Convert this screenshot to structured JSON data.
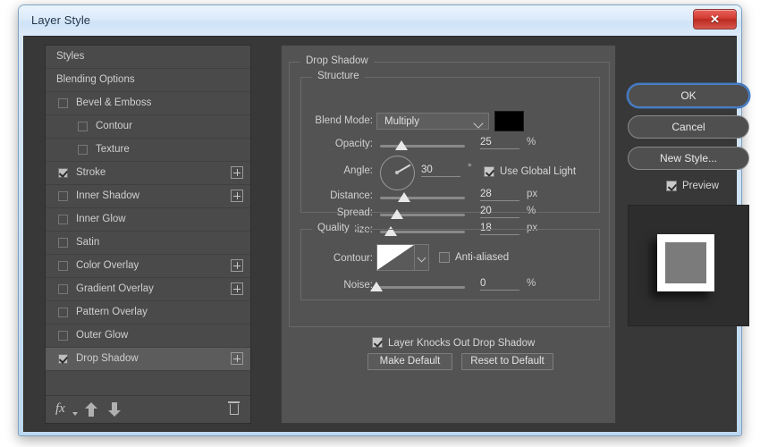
{
  "window": {
    "title": "Layer Style",
    "close_label": "✕"
  },
  "styles_panel": {
    "rows": [
      {
        "label": "Styles",
        "type": "header",
        "indent": 0,
        "checkbox": null,
        "plus": false
      },
      {
        "label": "Blending Options",
        "type": "header",
        "indent": 0,
        "checkbox": null,
        "plus": false
      },
      {
        "label": "Bevel & Emboss",
        "type": "item",
        "indent": 0,
        "checkbox": "off",
        "plus": false
      },
      {
        "label": "Contour",
        "type": "item",
        "indent": 1,
        "checkbox": "off",
        "plus": false
      },
      {
        "label": "Texture",
        "type": "item",
        "indent": 1,
        "checkbox": "off",
        "plus": false
      },
      {
        "label": "Stroke",
        "type": "item",
        "indent": 0,
        "checkbox": "on",
        "plus": true
      },
      {
        "label": "Inner Shadow",
        "type": "item",
        "indent": 0,
        "checkbox": "off",
        "plus": true
      },
      {
        "label": "Inner Glow",
        "type": "item",
        "indent": 0,
        "checkbox": "off",
        "plus": false
      },
      {
        "label": "Satin",
        "type": "item",
        "indent": 0,
        "checkbox": "off",
        "plus": false
      },
      {
        "label": "Color Overlay",
        "type": "item",
        "indent": 0,
        "checkbox": "off",
        "plus": true
      },
      {
        "label": "Gradient Overlay",
        "type": "item",
        "indent": 0,
        "checkbox": "off",
        "plus": true
      },
      {
        "label": "Pattern Overlay",
        "type": "item",
        "indent": 0,
        "checkbox": "off",
        "plus": false
      },
      {
        "label": "Outer Glow",
        "type": "item",
        "indent": 0,
        "checkbox": "off",
        "plus": false
      },
      {
        "label": "Drop Shadow",
        "type": "item",
        "indent": 0,
        "checkbox": "on",
        "plus": true,
        "selected": true
      }
    ],
    "toolbar": {
      "fx_label": "fx",
      "move_up": "move-up",
      "move_down": "move-down",
      "delete": "delete-effect"
    }
  },
  "settings": {
    "section_title": "Drop Shadow",
    "structure": {
      "legend": "Structure",
      "blend_mode_label": "Blend Mode:",
      "blend_mode_value": "Multiply",
      "shadow_color": "#000000",
      "opacity_label": "Opacity:",
      "opacity_value": "25",
      "opacity_unit": "%",
      "opacity_percent": 25,
      "angle_label": "Angle:",
      "angle_value": "30",
      "angle_unit": "°",
      "use_global_light_label": "Use Global Light",
      "use_global_light_checked": true,
      "distance_label": "Distance:",
      "distance_value": "28",
      "distance_unit": "px",
      "distance_percent": 28,
      "spread_label": "Spread:",
      "spread_value": "20",
      "spread_unit": "%",
      "spread_percent": 20,
      "size_label": "Size:",
      "size_value": "18",
      "size_unit": "px",
      "size_percent": 13
    },
    "quality": {
      "legend": "Quality",
      "contour_label": "Contour:",
      "anti_aliased_label": "Anti-aliased",
      "anti_aliased_checked": false,
      "noise_label": "Noise:",
      "noise_value": "0",
      "noise_unit": "%",
      "noise_percent": 0
    },
    "knockout_label": "Layer Knocks Out Drop Shadow",
    "knockout_checked": true,
    "make_default_label": "Make Default",
    "reset_default_label": "Reset to Default"
  },
  "actions": {
    "ok_label": "OK",
    "cancel_label": "Cancel",
    "new_style_label": "New Style...",
    "preview_label": "Preview",
    "preview_checked": true
  },
  "theme": {
    "accent": "#3f76c0",
    "panel_bg": "#535353",
    "dialog_bg": "#383838",
    "list_bg": "#4a4a4a"
  }
}
